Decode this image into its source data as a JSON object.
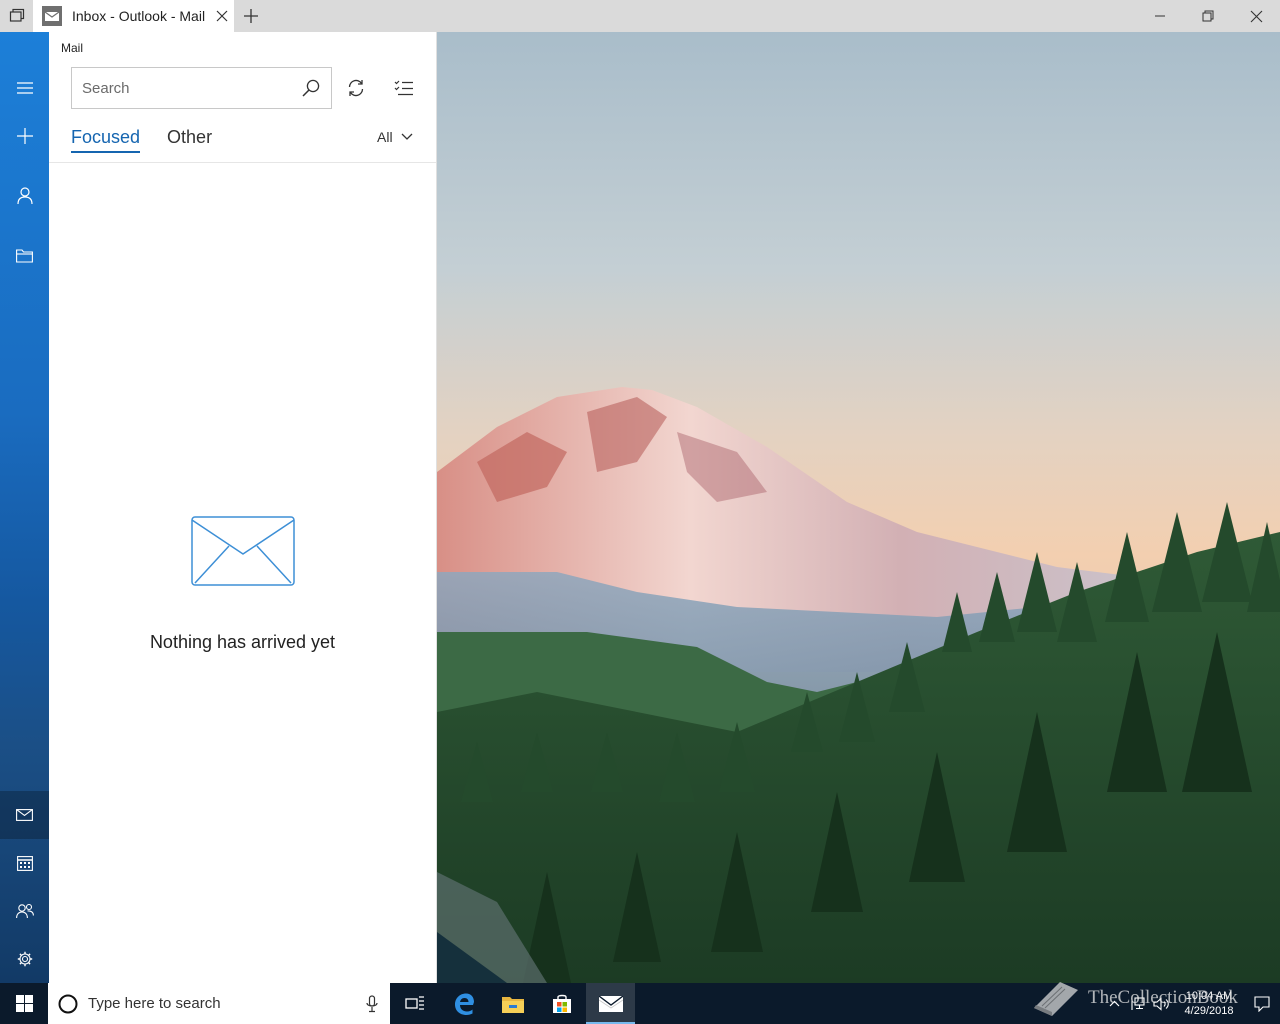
{
  "window": {
    "tab_title": "Inbox - Outlook - Mail"
  },
  "pane": {
    "title": "Mail",
    "search_placeholder": "Search",
    "tabs": [
      {
        "label": "Focused",
        "selected": true
      },
      {
        "label": "Other",
        "selected": false
      }
    ],
    "filter_label": "All",
    "empty_message": "Nothing has arrived yet"
  },
  "taskbar": {
    "search_placeholder": "Type here to search",
    "time": "10:04 AM",
    "date": "4/29/2018"
  },
  "watermark": "TheCollectionBook",
  "colors": {
    "accent": "#1565b0",
    "rail": "#1a6cc0",
    "taskbar": "#0b1a2b"
  },
  "icons": {
    "rail": [
      "hamburger-icon",
      "plus-icon",
      "person-icon",
      "folder-icon",
      "mail-icon",
      "calendar-icon",
      "people-icon",
      "gear-icon"
    ]
  }
}
